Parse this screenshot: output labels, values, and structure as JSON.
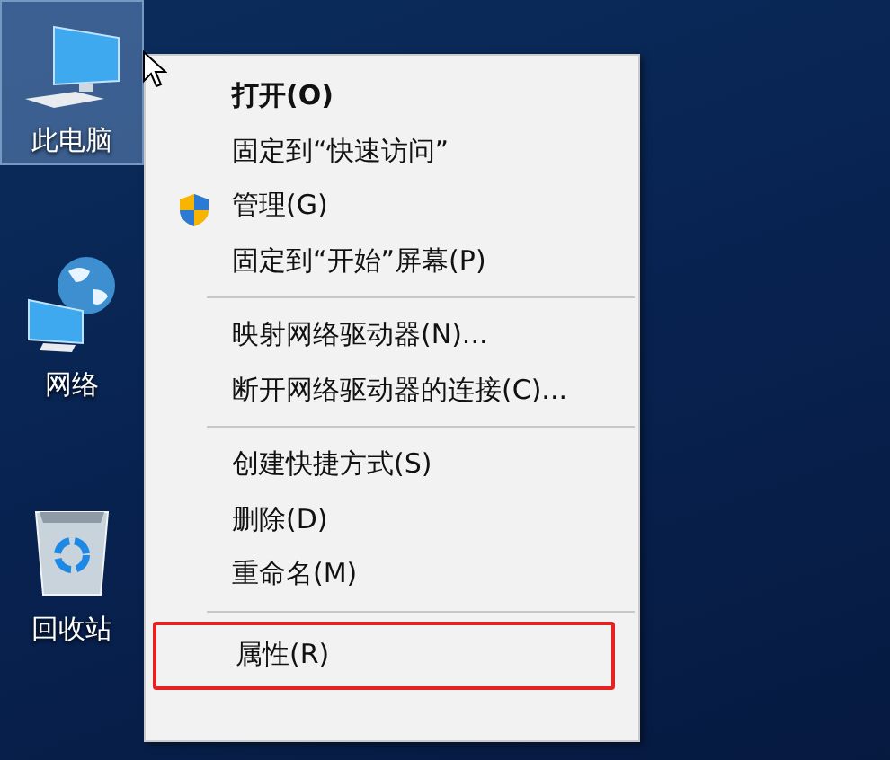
{
  "desktop_icons": [
    {
      "kind": "computer",
      "label": "此电脑",
      "selected": true
    },
    {
      "kind": "network",
      "label": "网络",
      "selected": false
    },
    {
      "kind": "recycle-bin",
      "label": "回收站",
      "selected": false
    }
  ],
  "context_menu": {
    "items": [
      {
        "kind": "default",
        "label": "打开(O)",
        "annotated": false
      },
      {
        "kind": "item",
        "label": "固定到“快速访问”",
        "annotated": false
      },
      {
        "kind": "shield-item",
        "label": "管理(G)",
        "annotated": false
      },
      {
        "kind": "item",
        "label": "固定到“开始”屏幕(P)",
        "annotated": false
      },
      {
        "kind": "separator"
      },
      {
        "kind": "item",
        "label": "映射网络驱动器(N)...",
        "annotated": false
      },
      {
        "kind": "item",
        "label": "断开网络驱动器的连接(C)...",
        "annotated": false
      },
      {
        "kind": "separator"
      },
      {
        "kind": "item",
        "label": "创建快捷方式(S)",
        "annotated": false
      },
      {
        "kind": "item",
        "label": "删除(D)",
        "annotated": false
      },
      {
        "kind": "item",
        "label": "重命名(M)",
        "annotated": false
      },
      {
        "kind": "separator"
      },
      {
        "kind": "item",
        "label": "属性(R)",
        "annotated": true
      }
    ]
  }
}
